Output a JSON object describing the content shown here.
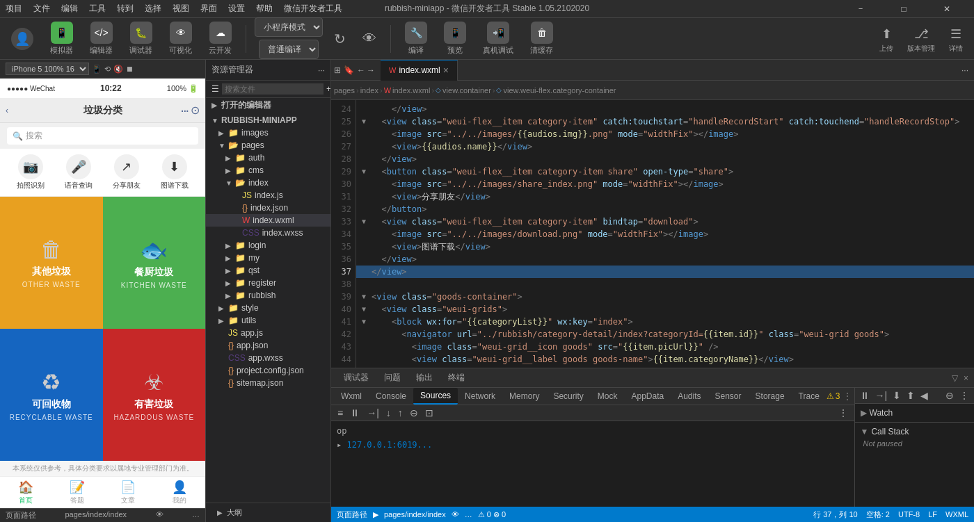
{
  "menubar": {
    "items": [
      "项目",
      "文件",
      "编辑",
      "工具",
      "转到",
      "选择",
      "视图",
      "界面",
      "设置",
      "帮助",
      "微信开发者工具"
    ],
    "title": "rubbish-miniapp - 微信开发者工具 Stable 1.05.2102020",
    "win_min": "－",
    "win_max": "□",
    "win_close": "✕"
  },
  "toolbar": {
    "simulator_label": "模拟器",
    "editor_label": "编辑器",
    "debugger_label": "调试器",
    "visible_label": "可视化",
    "cloud_label": "云开发",
    "mode_label": "小程序模式",
    "compile_label": "普通编译",
    "refresh_icon": "↻",
    "preview_icon": "👁",
    "real_device_label": "真机调试",
    "clear_cache_label": "清缓存",
    "upload_label": "上传",
    "version_label": "版本管理",
    "detail_label": "详情",
    "compile_btn_label": "编译",
    "preview_label": "预览"
  },
  "simulator": {
    "device": "iPhone 5",
    "zoom": "100%",
    "scale": "16",
    "status_bar": {
      "dots": "●●●●●",
      "carrier": "WeChat",
      "signal": "WiFi",
      "time": "10:22",
      "battery_pct": "100%",
      "battery_icon": "🔋"
    },
    "app_title": "垃圾分类",
    "search_placeholder": "搜索",
    "icons": [
      {
        "label": "拍照识别",
        "icon": "📷"
      },
      {
        "label": "语音查询",
        "icon": "🎤"
      },
      {
        "label": "分享朋友",
        "icon": "↗"
      },
      {
        "label": "图谱下载",
        "icon": "⬇"
      }
    ],
    "waste_categories": [
      {
        "name_cn": "其他垃圾",
        "name_en": "OTHER WASTE",
        "icon": "♻",
        "color": "waste-yellow"
      },
      {
        "name_cn": "餐厨垃圾",
        "name_en": "KITCHEN WASTE",
        "icon": "🐟",
        "color": "waste-green"
      },
      {
        "name_cn": "可回收物",
        "name_en": "RECYCLABLE WASTE",
        "icon": "♻",
        "color": "waste-blue"
      },
      {
        "name_cn": "有害垃圾",
        "name_en": "HAZARDOUS WASTE",
        "icon": "☢",
        "color": "waste-red"
      }
    ],
    "footer_text": "本系统仅供参考，具体分类要求以属地专业管理部门为准。",
    "nav_items": [
      {
        "label": "首页",
        "icon": "🏠",
        "active": true
      },
      {
        "label": "答题",
        "icon": "📝",
        "active": false
      },
      {
        "label": "文章",
        "icon": "📄",
        "active": false
      },
      {
        "label": "我的",
        "icon": "👤",
        "active": false
      }
    ],
    "path": "pages/index/index"
  },
  "filetree": {
    "header": "资源管理器",
    "sections": {
      "open_editors": "打开的编辑器",
      "project": "RUBBISH-MINIAPP"
    },
    "items": [
      {
        "name": "images",
        "type": "folder",
        "indent": 1,
        "expanded": false
      },
      {
        "name": "pages",
        "type": "folder",
        "indent": 1,
        "expanded": true
      },
      {
        "name": "auth",
        "type": "folder",
        "indent": 2,
        "expanded": false
      },
      {
        "name": "cms",
        "type": "folder",
        "indent": 2,
        "expanded": false
      },
      {
        "name": "index",
        "type": "folder",
        "indent": 2,
        "expanded": true
      },
      {
        "name": "index.js",
        "type": "js",
        "indent": 3
      },
      {
        "name": "index.json",
        "type": "json",
        "indent": 3
      },
      {
        "name": "index.wxml",
        "type": "wxml",
        "indent": 3,
        "selected": true
      },
      {
        "name": "index.wxss",
        "type": "wxss",
        "indent": 3
      },
      {
        "name": "login",
        "type": "folder",
        "indent": 2,
        "expanded": false
      },
      {
        "name": "my",
        "type": "folder",
        "indent": 2,
        "expanded": false
      },
      {
        "name": "qst",
        "type": "folder",
        "indent": 2,
        "expanded": false
      },
      {
        "name": "register",
        "type": "folder",
        "indent": 2,
        "expanded": false
      },
      {
        "name": "rubbish",
        "type": "folder",
        "indent": 2,
        "expanded": false
      },
      {
        "name": "style",
        "type": "folder",
        "indent": 1,
        "expanded": false
      },
      {
        "name": "utils",
        "type": "folder",
        "indent": 1,
        "expanded": false
      },
      {
        "name": "app.js",
        "type": "js",
        "indent": 1
      },
      {
        "name": "app.json",
        "type": "json",
        "indent": 1
      },
      {
        "name": "app.wxss",
        "type": "wxss",
        "indent": 1
      },
      {
        "name": "project.config.json",
        "type": "json",
        "indent": 1
      },
      {
        "name": "sitemap.json",
        "type": "json",
        "indent": 1
      }
    ],
    "outline": "大纲"
  },
  "editor": {
    "tab_filename": "index.wxml",
    "breadcrumb": [
      "pages",
      "index",
      "index.wxml",
      "view.container",
      "view.weui-flex.category-container"
    ],
    "lines": [
      {
        "num": 24,
        "code": "    </view>",
        "fold": false,
        "highlight": false
      },
      {
        "num": 25,
        "code": "  <view class=\"weui-flex__item category-item\" catch:touchstart=\"handleRecordStart\" catch:touchend=\"handleRecordStop\">",
        "fold": true,
        "highlight": false
      },
      {
        "num": 26,
        "code": "    <image src=\"../../images/{{audios.img}}.png\" mode=\"widthFix\"></image>",
        "fold": false,
        "highlight": false
      },
      {
        "num": 27,
        "code": "    <view>{{audios.name}}</view>",
        "fold": false,
        "highlight": false
      },
      {
        "num": 28,
        "code": "  </view>",
        "fold": false,
        "highlight": false
      },
      {
        "num": 29,
        "code": "  <button class=\"weui-flex__item category-item share\" open-type=\"share\">",
        "fold": true,
        "highlight": false
      },
      {
        "num": 30,
        "code": "    <image src=\"../../images/share_index.png\" mode=\"widthFix\"></image>",
        "fold": false,
        "highlight": false
      },
      {
        "num": 31,
        "code": "    <view>分享朋友</view>",
        "fold": false,
        "highlight": false
      },
      {
        "num": 32,
        "code": "  </button>",
        "fold": false,
        "highlight": false
      },
      {
        "num": 33,
        "code": "  <view class=\"weui-flex__item category-item\" bindtap=\"download\">",
        "fold": true,
        "highlight": false
      },
      {
        "num": 34,
        "code": "    <image src=\"../../images/download.png\" mode=\"widthFix\"></image>",
        "fold": false,
        "highlight": false
      },
      {
        "num": 35,
        "code": "    <view>图谱下载</view>",
        "fold": false,
        "highlight": false
      },
      {
        "num": 36,
        "code": "  </view>",
        "fold": false,
        "highlight": false
      },
      {
        "num": 37,
        "code": "</view>",
        "fold": false,
        "highlight": true
      },
      {
        "num": 38,
        "code": "",
        "fold": false,
        "highlight": false
      },
      {
        "num": 39,
        "code": "<view class=\"goods-container\">",
        "fold": true,
        "highlight": false
      },
      {
        "num": 40,
        "code": "  <view class=\"weui-grids\">",
        "fold": true,
        "highlight": false
      },
      {
        "num": 41,
        "code": "    <block wx:for=\"{{categoryList}}\" wx:key=\"index\">",
        "fold": true,
        "highlight": false
      },
      {
        "num": 42,
        "code": "      <navigator url=\"../rubbish/category-detail/index?categoryId={{item.id}}\" class=\"weui-grid goods\">",
        "fold": false,
        "highlight": false
      },
      {
        "num": 43,
        "code": "        <image class=\"weui-grid__icon goods\" src=\"{{item.picUrl}}\" />",
        "fold": false,
        "highlight": false
      },
      {
        "num": 44,
        "code": "        <view class=\"weui-grid__label goods goods-name\">{{item.categoryName}}</view>",
        "fold": false,
        "highlight": false
      }
    ]
  },
  "devtools": {
    "tabs": [
      "调试器",
      "问题",
      "输出",
      "终端"
    ],
    "panel_tabs": [
      "Wxml",
      "Console",
      "Sources",
      "Network",
      "Memory",
      "Security",
      "Mock",
      "AppData",
      "Audits",
      "Sensor",
      "Storage",
      "Trace"
    ],
    "active_tab": "Sources",
    "console_content": [
      "op",
      "▸ 127.0.0.1:6019..."
    ],
    "watch_label": "Watch",
    "callstack_label": "Call Stack",
    "not_paused": "Not paused",
    "warning_count": "3"
  },
  "statusbar": {
    "path": "页面路径",
    "page_path": "pages/index/index",
    "line_col": "行 37，列 10",
    "encoding": "UTF-8",
    "line_ending": "LF",
    "file_type": "WXML",
    "spaces": "空格: 2",
    "warning_icon": "⚠",
    "warnings": "0",
    "errors": "0",
    "eye_icon": "👁",
    "more_icon": "…"
  }
}
